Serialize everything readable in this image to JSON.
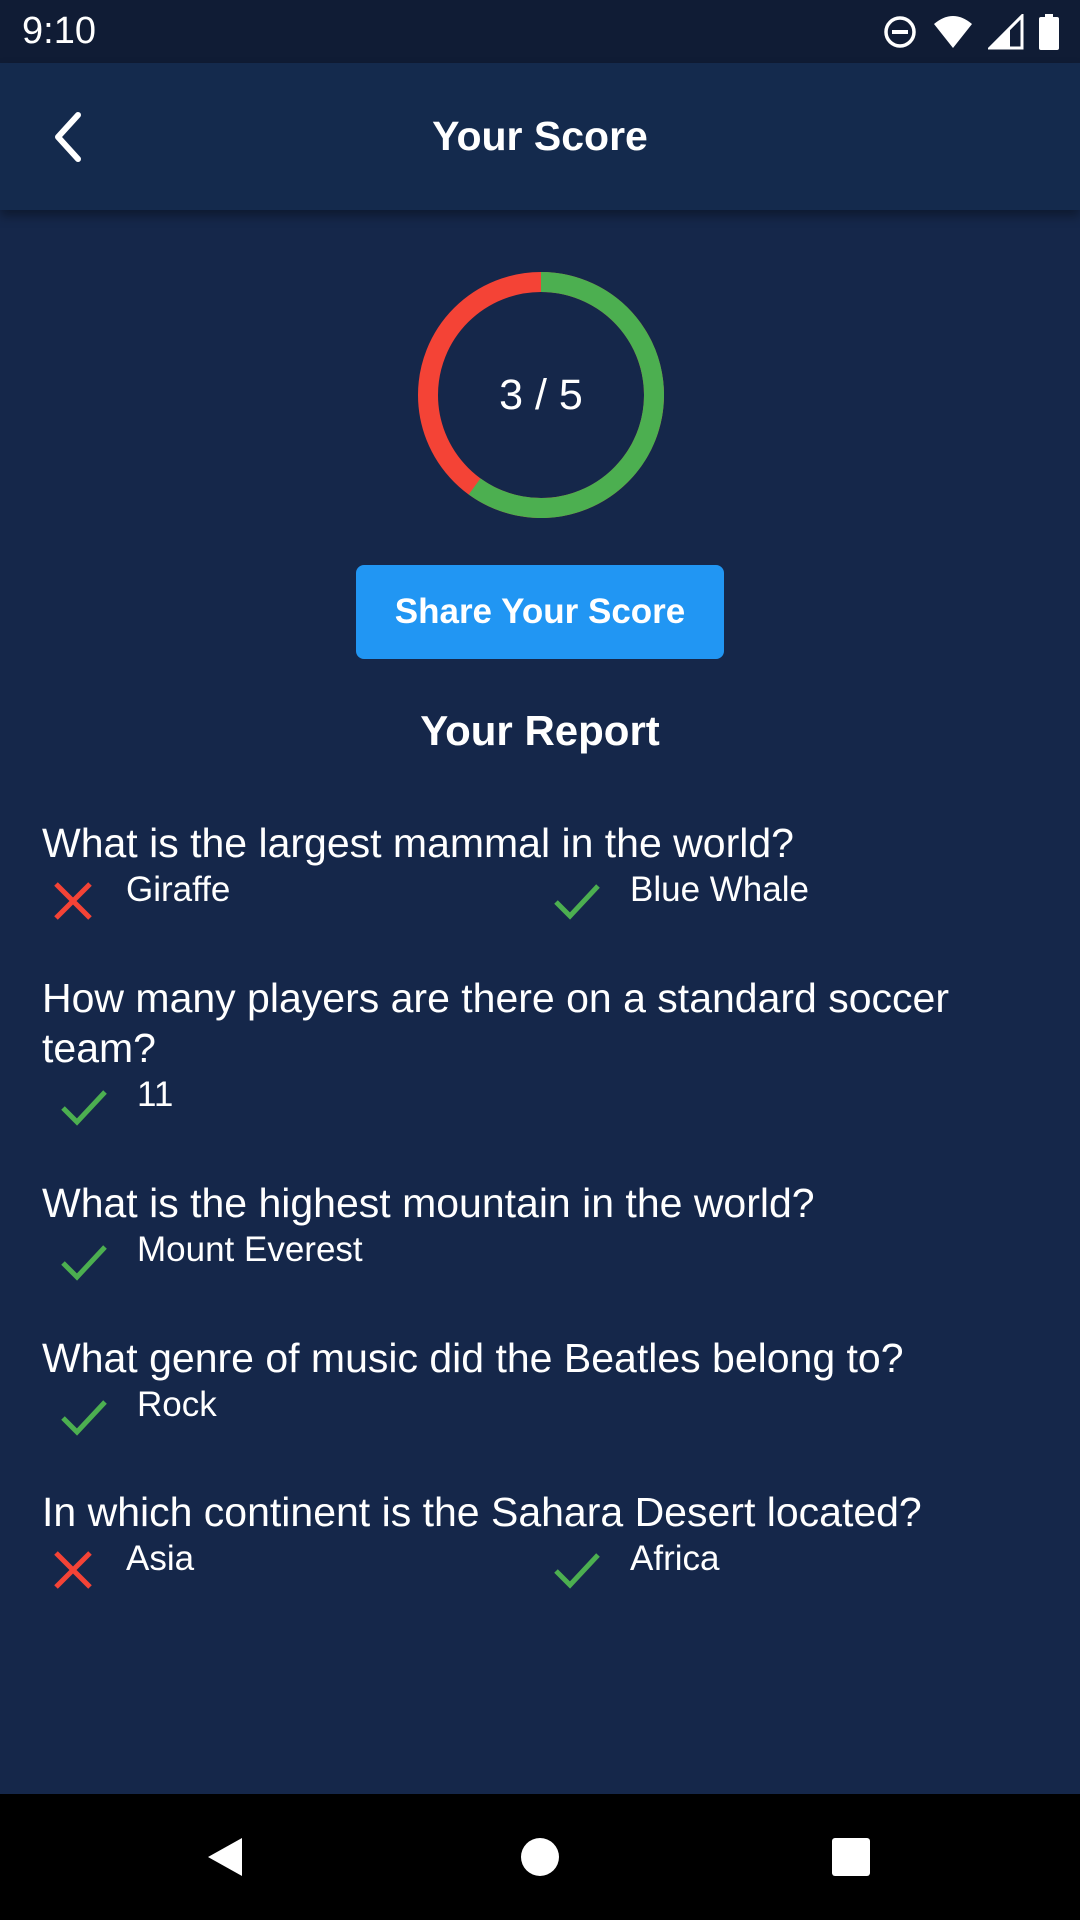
{
  "status_bar": {
    "time": "9:10",
    "icons": [
      "do-not-disturb-icon",
      "wifi-icon",
      "signal-icon",
      "battery-icon"
    ]
  },
  "header": {
    "title": "Your Score",
    "back_icon": "chevron-left-icon"
  },
  "score": {
    "text": "3 / 5",
    "correct": 3,
    "total": 5,
    "correct_color": "#4caf50",
    "wrong_color": "#f44336"
  },
  "share_button": {
    "label": "Share Your Score",
    "color": "#2196f3"
  },
  "report": {
    "title": "Your Report",
    "items": [
      {
        "question": "What is the largest mammal in the world?",
        "correct": false,
        "selected_answer": "Giraffe",
        "correct_answer": "Blue Whale"
      },
      {
        "question": "How many players are there on a standard soccer team?",
        "correct": true,
        "selected_answer": "11"
      },
      {
        "question": "What is the highest mountain in the world?",
        "correct": true,
        "selected_answer": "Mount Everest"
      },
      {
        "question": "What genre of music did the Beatles belong to?",
        "correct": true,
        "selected_answer": "Rock"
      },
      {
        "question": "In which continent is the Sahara Desert located?",
        "correct": false,
        "selected_answer": "Asia",
        "correct_answer": "Africa"
      }
    ]
  },
  "nav_bar": {
    "buttons": [
      "back-triangle-icon",
      "home-circle-icon",
      "recents-square-icon"
    ]
  }
}
